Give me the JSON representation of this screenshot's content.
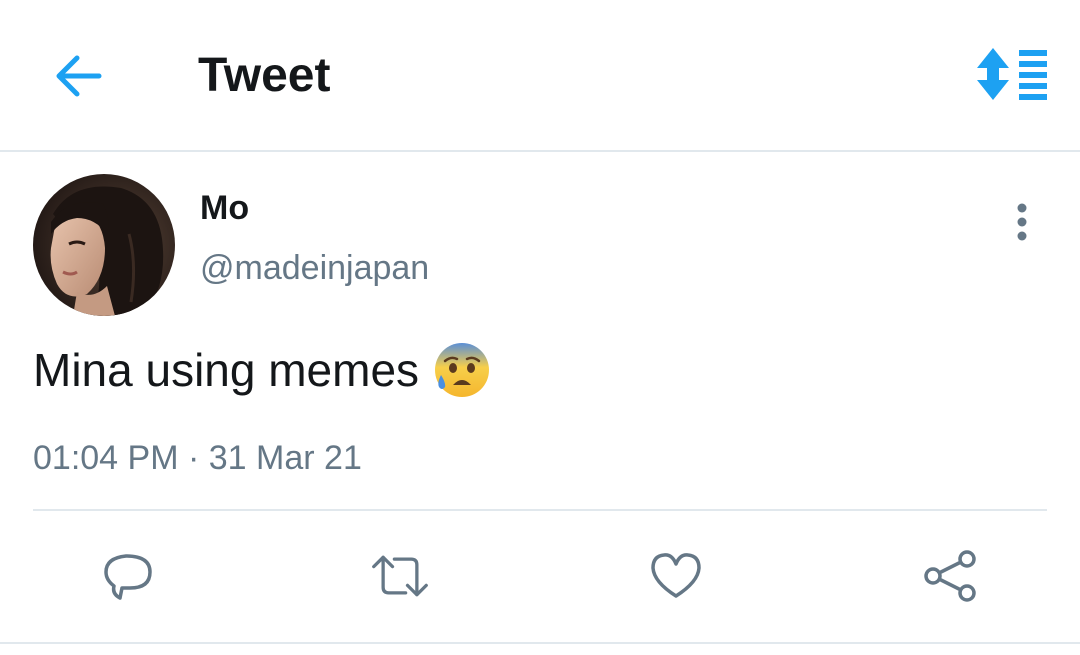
{
  "header": {
    "title": "Tweet",
    "back_icon": "arrow-left-icon",
    "sort_icon": "sort-replies-icon",
    "accent_color": "#1da1f2"
  },
  "tweet": {
    "author": {
      "display_name": "Mo",
      "handle": "@madeinjapan",
      "avatar": "profile-photo"
    },
    "text": "Mina using memes",
    "emoji": "anxious-face-with-sweat-emoji",
    "time": "01:04 PM",
    "separator": "·",
    "date": "31 Mar 21",
    "more_icon": "more-vertical-icon"
  },
  "actions": [
    {
      "name": "reply",
      "icon": "reply-icon"
    },
    {
      "name": "retweet",
      "icon": "retweet-icon"
    },
    {
      "name": "like",
      "icon": "heart-icon"
    },
    {
      "name": "share",
      "icon": "share-icon"
    }
  ],
  "colors": {
    "text_primary": "#14171a",
    "text_secondary": "#657786",
    "divider": "#e1e8ed"
  }
}
